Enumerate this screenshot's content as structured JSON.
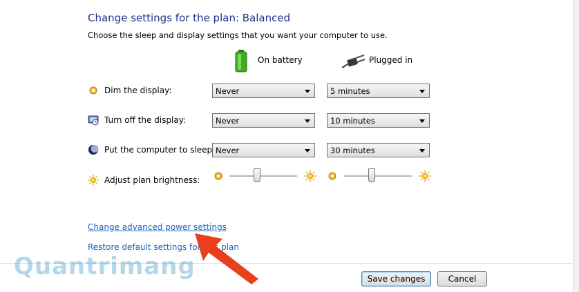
{
  "header": {
    "title": "Change settings for the plan: Balanced",
    "subtitle": "Choose the sleep and display settings that you want your computer to use."
  },
  "columns": {
    "on_battery": "On battery",
    "plugged_in": "Plugged in"
  },
  "settings": [
    {
      "label": "Dim the display:",
      "on_battery": "Never",
      "plugged_in": "5 minutes",
      "icon": "dim-display-icon"
    },
    {
      "label": "Turn off the display:",
      "on_battery": "Never",
      "plugged_in": "10 minutes",
      "icon": "display-off-icon"
    },
    {
      "label": "Put the computer to sleep:",
      "on_battery": "Never",
      "plugged_in": "30 minutes",
      "icon": "sleep-icon"
    }
  ],
  "brightness": {
    "label": "Adjust plan brightness:",
    "on_battery_level": 0.4,
    "plugged_in_level": 0.4
  },
  "links": {
    "advanced": "Change advanced power settings",
    "restore": "Restore default settings for this plan"
  },
  "buttons": {
    "save": "Save changes",
    "cancel": "Cancel"
  },
  "watermark": "Quantrimang",
  "colors": {
    "title": "#1e3287",
    "link": "#1c62b9",
    "annotation_arrow": "#e8401c"
  }
}
